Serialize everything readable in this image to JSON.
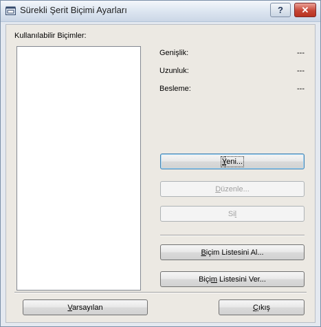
{
  "window": {
    "title": "Sürekli Şerit Biçimi Ayarları",
    "help_label": "?",
    "close_label": "✕"
  },
  "formats": {
    "label": "Kullanılabilir Biçimler:",
    "items": []
  },
  "details": {
    "width_label": "Genişlik:",
    "width_value": "---",
    "length_label": "Uzunluk:",
    "length_value": "---",
    "feed_label": "Besleme:",
    "feed_value": "---"
  },
  "buttons": {
    "new": {
      "pre": "",
      "key": "Y",
      "post": "eni..."
    },
    "edit": {
      "pre": "",
      "key": "D",
      "post": "üzenle..."
    },
    "delete": {
      "pre": "Si",
      "key": "l",
      "post": ""
    },
    "get_list": {
      "pre": "",
      "key": "B",
      "post": "içim Listesini Al..."
    },
    "send_list": {
      "pre": "Biçi",
      "key": "m",
      "post": " Listesini Ver..."
    },
    "defaults": {
      "pre": "",
      "key": "V",
      "post": "arsayılan"
    },
    "exit": {
      "pre": "",
      "key": "Ç",
      "post": "ıkış"
    }
  },
  "colors": {
    "accent": "#3c7fb1",
    "close": "#c64636",
    "dialog_bg": "#ece9e3"
  }
}
